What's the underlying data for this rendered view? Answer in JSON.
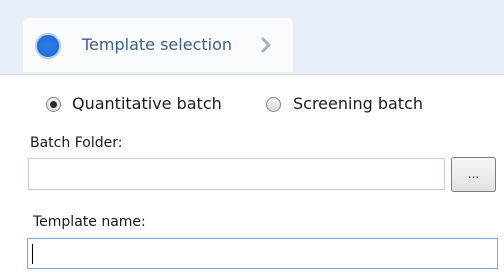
{
  "breadcrumb": {
    "step_label": "Template selection"
  },
  "batch_type": {
    "options": [
      {
        "label": "Quantitative batch",
        "selected": true
      },
      {
        "label": "Screening batch",
        "selected": false
      }
    ]
  },
  "batch_folder": {
    "label": "Batch Folder:",
    "value": "",
    "browse_label": "..."
  },
  "template_name": {
    "label": "Template name:",
    "value": ""
  },
  "colors": {
    "step_indicator": "#2172dc",
    "breadcrumb_text": "#3d5f8a"
  }
}
